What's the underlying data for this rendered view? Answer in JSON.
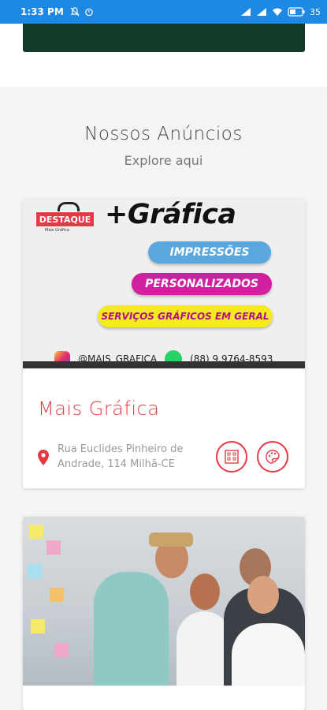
{
  "status_bar": {
    "time": "1:33 PM",
    "battery": "35"
  },
  "section": {
    "title": "Nossos Anúncios",
    "subtitle": "Explore aqui"
  },
  "listings": [
    {
      "ad": {
        "badge": "DESTAQUE",
        "badge_sub": "Mais Gráfica",
        "brand": "+Gráfica",
        "pills": [
          "IMPRESSÕES",
          "PERSONALIZADOS",
          "SERVIÇOS GRÁFICOS EM GERAL"
        ],
        "handle": "@MAIS_GRAFICA",
        "phone": "(88) 9.9764-8593"
      },
      "title": "Mais Gráfica",
      "address": "Rua Euclides Pinheiro de Andrade, 114 Milhã-CE"
    }
  ],
  "colors": {
    "accent": "#e53945",
    "status_bar": "#1e88e5",
    "top_banner": "#123a27"
  }
}
